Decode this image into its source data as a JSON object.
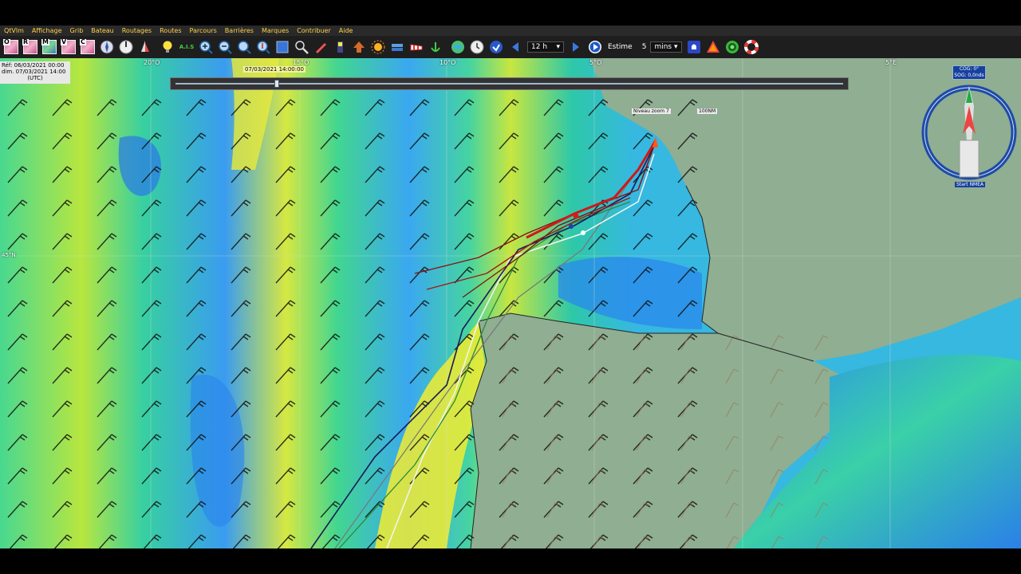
{
  "menu": [
    "QtVlm",
    "Affichage",
    "Grib",
    "Bateau",
    "Routages",
    "Routes",
    "Parcours",
    "Barrières",
    "Marques",
    "Contribuer",
    "Aide"
  ],
  "toolbar": {
    "grib_buttons": [
      "O",
      "R",
      "M",
      "V",
      "C"
    ],
    "ais_label": "A.I.S",
    "interval": "12 h",
    "estime_label": "Estime",
    "estime_value": "5",
    "estime_unit": "mins"
  },
  "map": {
    "date_lines": [
      "Réf: 06/03/2021 00:00",
      "dim. 07/03/2021 14:00",
      "(UTC)"
    ],
    "timeline_label": "07/03/2021 14:00:00",
    "timeline_fraction": 0.152,
    "lon_labels": [
      "20°O",
      "15°O",
      "10°O",
      "5°O",
      "5°E"
    ],
    "lat_label": "45°N",
    "zoom_label": "Niveau zoom 7",
    "scale_label": "100NM",
    "cog_text": "COG: 0°",
    "sog_text": "SOG: 0,0nds",
    "start_label": "Start NMEA",
    "colors": {
      "sea_yellow": "#f2ec30",
      "sea_green": "#3fd88a",
      "sea_blue": "#2a8ef0",
      "land": "#8fae92",
      "route_red": "#c81414"
    }
  }
}
